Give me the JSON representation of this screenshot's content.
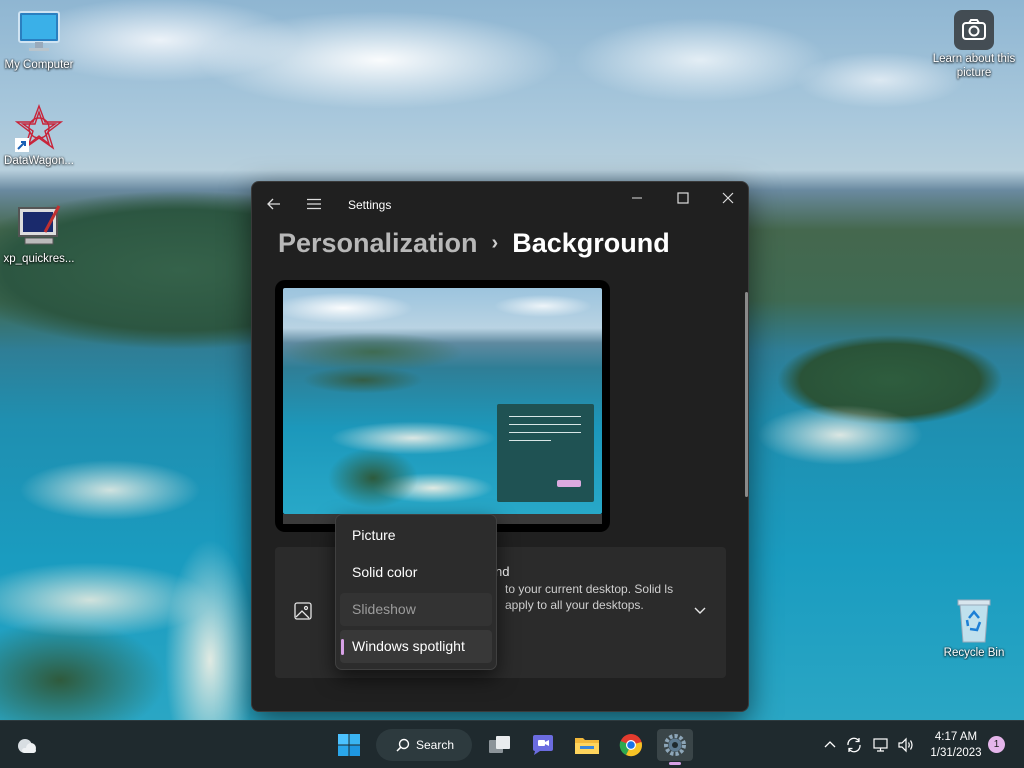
{
  "desktop": {
    "icons": [
      {
        "label": "My Computer",
        "icon": "monitor-icon"
      },
      {
        "label": "DataWagon...",
        "icon": "datawagon-icon"
      },
      {
        "label": "xp_quickres...",
        "icon": "quickres-icon"
      },
      {
        "label": "Learn about this picture",
        "icon": "camera-icon"
      },
      {
        "label": "Recycle Bin",
        "icon": "recycle-bin-icon"
      }
    ]
  },
  "window": {
    "title": "Settings",
    "breadcrumb": {
      "parent": "Personalization",
      "separator": "›",
      "current": "Background"
    },
    "card": {
      "title": "nd",
      "description": "to your current desktop. Solid ls apply to all your desktops."
    }
  },
  "dropdown": {
    "items": [
      {
        "label": "Picture",
        "state": "normal"
      },
      {
        "label": "Solid color",
        "state": "normal"
      },
      {
        "label": "Slideshow",
        "state": "hovered"
      },
      {
        "label": "Windows spotlight",
        "state": "selected"
      }
    ],
    "accent": "#d7a1e6"
  },
  "taskbar": {
    "search_label": "Search",
    "apps": [
      "windows-start-icon",
      "task-view-icon",
      "teams-chat-icon",
      "file-explorer-icon",
      "chrome-icon",
      "settings-gear-icon"
    ],
    "clock_time": "4:17 AM",
    "clock_date": "1/31/2023",
    "notification_count": "1"
  }
}
